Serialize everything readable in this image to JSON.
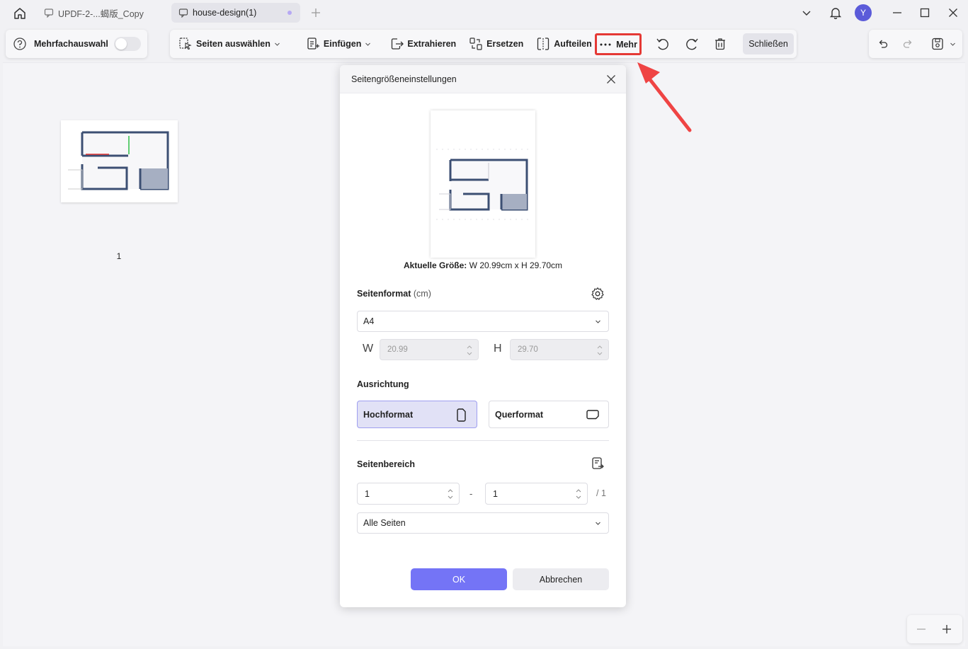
{
  "titlebar": {
    "tabs": [
      {
        "label": "UPDF-2-...蝎版_Copy"
      },
      {
        "label": "house-design(1)"
      }
    ],
    "avatar_letter": "Y"
  },
  "toolbar": {
    "multi_select_label": "Mehrfachauswahl",
    "select_pages_label": "Seiten auswählen",
    "insert_label": "Einfügen",
    "extract_label": "Extrahieren",
    "replace_label": "Ersetzen",
    "split_label": "Aufteilen",
    "more_label": "Mehr",
    "close_label": "Schließen",
    "highlight_color": "#e53935"
  },
  "pages": {
    "thumbnail_page_number": "1"
  },
  "dialog": {
    "title": "Seitengrößeneinstellungen",
    "current_size_label": "Aktuelle Größe:",
    "current_size_value": "W 20.99cm x H 29.70cm",
    "page_format_label": "Seitenformat",
    "page_format_unit": "(cm)",
    "page_format_value": "A4",
    "width_letter": "W",
    "width_value": "20.99",
    "height_letter": "H",
    "height_value": "29.70",
    "orientation_label": "Ausrichtung",
    "portrait_label": "Hochformat",
    "landscape_label": "Querformat",
    "page_range_label": "Seitenbereich",
    "range_from": "1",
    "range_dash": "-",
    "range_to": "1",
    "range_total": "/ 1",
    "range_option": "Alle Seiten",
    "ok_label": "OK",
    "cancel_label": "Abbrechen",
    "accent_color": "#7474f6"
  }
}
